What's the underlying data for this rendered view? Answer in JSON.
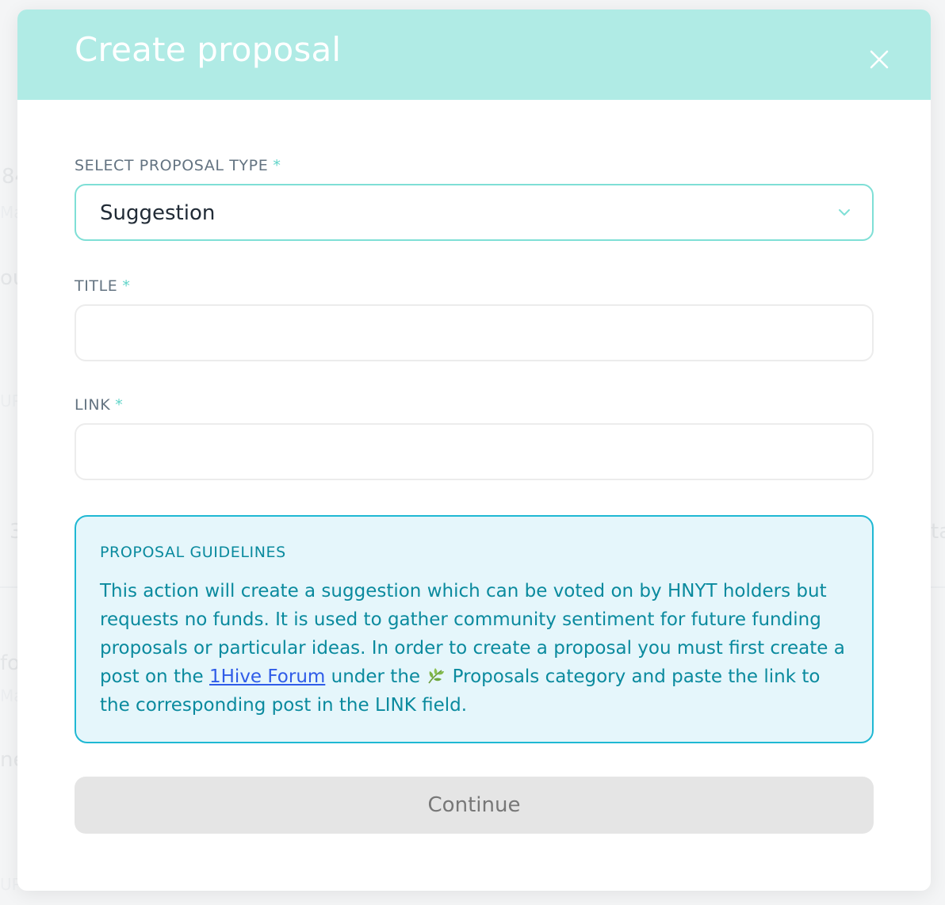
{
  "modal": {
    "title": "Create proposal",
    "close_icon": "close-icon"
  },
  "proposal_type": {
    "label": "SELECT PROPOSAL TYPE",
    "required_mark": "*",
    "value": "Suggestion",
    "icon": "chevron-down-icon"
  },
  "title_field": {
    "label": "TITLE",
    "required_mark": "*",
    "value": ""
  },
  "link_field": {
    "label": "LINK",
    "required_mark": "*",
    "value": ""
  },
  "guidelines": {
    "title": "PROPOSAL GUIDELINES",
    "text_before_link": "This action will create a suggestion which can be voted on by HNYT holders but requests no funds. It is used to gather community sentiment for future funding proposals or particular ideas. In order to create a proposal you must first create a post on the ",
    "link_text": "1Hive Forum",
    "text_after_link": " under the ",
    "category_icon": "leaf-icon",
    "text_end": " Proposals category and paste the link to the corresponding post in the LINK field."
  },
  "actions": {
    "continue_label": "Continue"
  },
  "colors": {
    "header": "#b0ebe5",
    "accent": "#7fdfd6",
    "guidelines_bg": "#e5f6fb",
    "guidelines_border": "#1fb8d3",
    "guidelines_text": "#0a8a9e",
    "link": "#2f5ce8",
    "button_disabled": "#e5e5e5"
  }
}
